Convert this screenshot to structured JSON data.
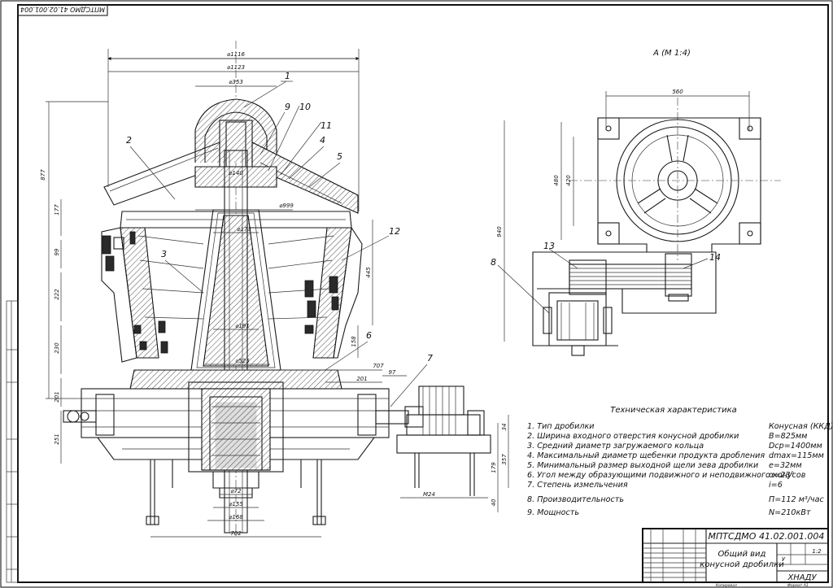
{
  "stamp_top": "МПТСДМО 41.02.001.004",
  "view_label": "А (М 1:4)",
  "dimensions": {
    "d1116": "⌀1116",
    "d1123": "⌀1123",
    "d353": "⌀353",
    "d140": "⌀140",
    "d999": "⌀999",
    "d173": "⌀173",
    "d191": "⌀191",
    "d525": "⌀525",
    "d72": "⌀72",
    "d155": "⌀155",
    "d168": "⌀168",
    "w702": "702",
    "v877": "877",
    "v177": "177",
    "v99": "99",
    "v222": "222",
    "v230": "230",
    "v201": "201",
    "v251": "251",
    "v445": "445",
    "v158": "158",
    "v707": "707",
    "v201b": "201",
    "v97": "97",
    "v560": "560",
    "v480": "480",
    "v420": "420",
    "v940": "940",
    "v179": "179",
    "v357": "357",
    "v40": "40",
    "v34": "34",
    "m24": "M24"
  },
  "callouts": [
    "1",
    "2",
    "3",
    "4",
    "5",
    "6",
    "7",
    "8",
    "9",
    "10",
    "11",
    "12",
    "13",
    "14"
  ],
  "spec": {
    "heading": "Техническая характеристика",
    "rows": [
      {
        "label": "1. Тип дробилки",
        "value": "Конусная (ККД)"
      },
      {
        "label": "2. Ширина входного отверстия конусной дробилки",
        "value": "B=825мм"
      },
      {
        "label": "3. Средний диаметр загружаемого кольца",
        "value": "Dср=1400мм"
      },
      {
        "label": "4. Максимальный диаметр щебенки продукта дробления",
        "value": "dmax=115мм"
      },
      {
        "label": "5. Минимальный размер выходной щели зева дробилки",
        "value": "e=32мм"
      },
      {
        "label": "6. Угол между образующими подвижного и неподвижного конусов",
        "value": "α=23°"
      },
      {
        "label": "7. Степень измельчения",
        "value": "i=6"
      },
      {
        "label": "8. Производительность",
        "value": "П=112 м³/час"
      },
      {
        "label": "9. Мощность",
        "value": "N=210кВт"
      }
    ]
  },
  "title_block": {
    "code": "МПТСДМО 41.02.001.004",
    "name1": "Общий вид",
    "name2": "конусной дробилки",
    "lit": "У",
    "scale": "1:2",
    "org": "ХНАДУ",
    "copied": "Копировал",
    "format": "Формат А1"
  }
}
